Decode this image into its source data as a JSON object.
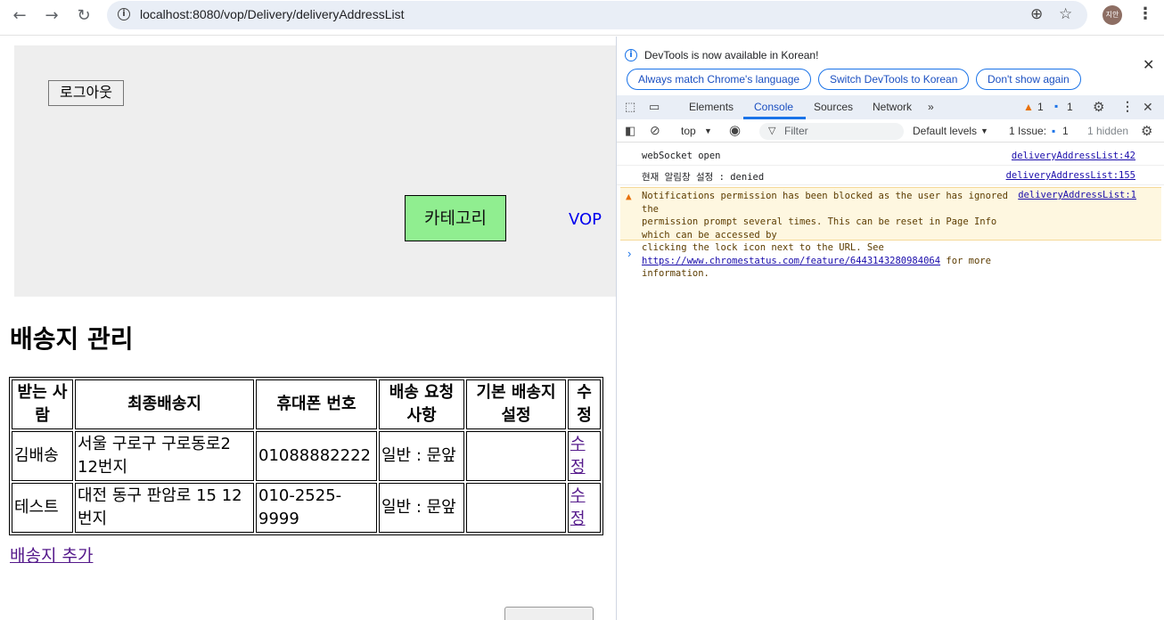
{
  "browser": {
    "back_icon": "←",
    "forward_icon": "→",
    "reload_icon": "↻",
    "info_glyph": "i",
    "url": "localhost:8080/vop/Delivery/deliveryAddressList",
    "zoom_icon": "⊕",
    "star_icon": "☆",
    "avatar_text": "지안",
    "menu_icon": "⋮"
  },
  "header": {
    "logout_label": "로그아웃",
    "category_label": "카테고리",
    "brand": "VOP"
  },
  "page": {
    "title": "배송지 관리",
    "add_link": "배송지 추가"
  },
  "table": {
    "headers": [
      "받는 사람",
      "최종배송지",
      "휴대폰 번호",
      "배송 요청 사항",
      "기본 배송지 설정",
      "수정"
    ],
    "rows": [
      {
        "recipient": "김배송",
        "address": "서울 구로구 구로동로2 12번지",
        "phone": "01088882222",
        "request": "일반 : 문앞",
        "default": "",
        "edit": "수정"
      },
      {
        "recipient": "테스트",
        "address": "대전 동구 판암로 15 12번지",
        "phone": "010-2525-9999",
        "request": "일반 : 문앞",
        "default": "",
        "edit": "수정"
      }
    ]
  },
  "devtools": {
    "banner": {
      "message": "DevTools is now available in Korean!",
      "btn_match": "Always match Chrome's language",
      "btn_switch": "Switch DevTools to Korean",
      "btn_dont_show": "Don't show again",
      "close": "✕"
    },
    "tabs": [
      "Elements",
      "Console",
      "Sources",
      "Network"
    ],
    "more_tabs": "»",
    "warn_count": "1",
    "msg_count": "1",
    "toolbar": {
      "context": "top",
      "filter_placeholder": "Filter",
      "levels": "Default levels",
      "issues": "1 Issue:",
      "issue_count": "1",
      "hidden": "1 hidden"
    },
    "logs": [
      {
        "message": "webSocket open",
        "source": "deliveryAddressList:42"
      },
      {
        "message": "현재 알림창 설정 : denied",
        "source": "deliveryAddressList:155"
      }
    ],
    "warning": {
      "text": "Notifications permission has been blocked as the user has ignored the\npermission prompt several times. This can be reset in Page Info which can be accessed by\nclicking the lock icon next to the URL. See",
      "link": "https://www.chromestatus.com/feature/6443143280984064",
      "tail": " for more information.",
      "source": "deliveryAddressList:1"
    },
    "prompt": "›"
  },
  "colors": {
    "category_bg": "#90ee90",
    "header_bg": "#eeeeee",
    "link": "#551a8b",
    "brand": "#0000ee",
    "devtools_accent": "#1a73e8",
    "warning_bg": "#fef7e0"
  }
}
